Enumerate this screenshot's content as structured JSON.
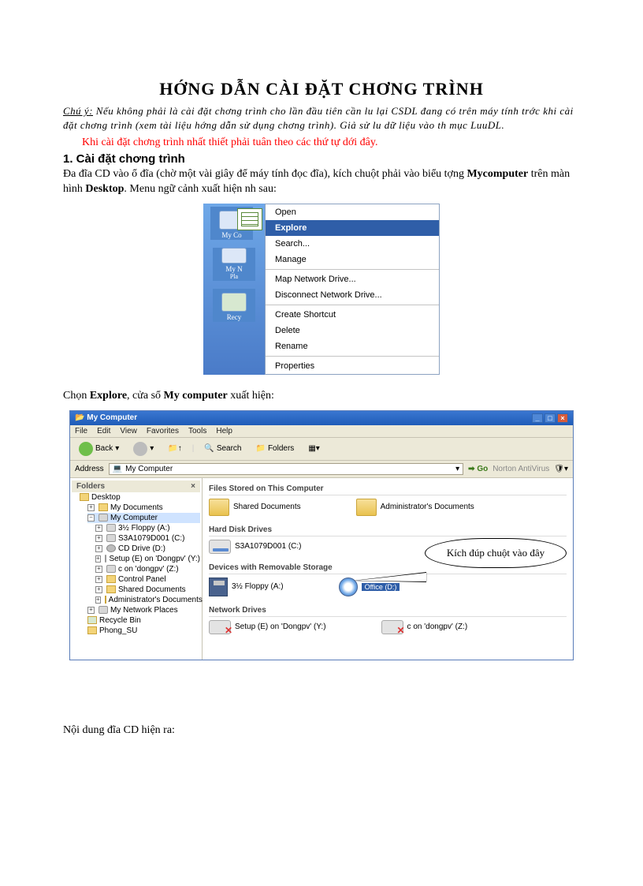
{
  "title": "HỚNG   DẪN CÀI ĐẶT CHƠNG    TRÌNH",
  "note_label": "Chú ý:",
  "note_body": " Nếu không phải là cài đặt chơng   trình cho lần đầu tiên cần lu   lại CSDL đang có trên máy tính trớc   khi cài đặt chơng   trình (xem tài liệu hớng   dẫn sử dụng chơng   trình). Giả sử lu   dữ liệu vào th   mục LuuDL.",
  "red_text": "Khi cài đặt chơng   trình nhất thiết phải tuân theo các thứ tự dới   đây.",
  "h1": "1. Cài đặt chơng   trình",
  "para1_a": "Đa   đĩa CD vào ổ đĩa (chờ một vài giây để máy tính đọc đĩa), kích chuột phải vào biểu tợng   ",
  "para1_b": "Mycomputer",
  "para1_c": " trên màn hình ",
  "para1_d": "Desktop",
  "para1_e": ". Menu ngữ cảnh xuất hiện nh   sau:",
  "ctx": {
    "myco": "My Co",
    "myn": "My N",
    "pla": "Pla",
    "recy": "Recy",
    "items": [
      "Open",
      "Explore",
      "Search...",
      "Manage",
      "Map Network Drive...",
      "Disconnect Network Drive...",
      "Create Shortcut",
      "Delete",
      "Rename",
      "Properties"
    ]
  },
  "para2_a": "Chọn ",
  "para2_b": "Explore",
  "para2_c": ", cửa sổ ",
  "para2_d": "My computer",
  "para2_e": " xuất hiện:",
  "explorer": {
    "title": "My Computer",
    "menu": [
      "File",
      "Edit",
      "View",
      "Favorites",
      "Tools",
      "Help"
    ],
    "back": "Back",
    "search": "Search",
    "folders": "Folders",
    "addr_label": "Address",
    "addr_value": "My Computer",
    "go": "Go",
    "norton": "Norton AntiVirus",
    "tree_hdr": "Folders",
    "tree": {
      "desktop": "Desktop",
      "mydocs": "My Documents",
      "mycomp": "My Computer",
      "floppy": "3½ Floppy (A:)",
      "cdrive": "S3A1079D001 (C:)",
      "cddrive": "CD Drive (D:)",
      "setup": "Setup (E) on 'Dongpv' (Y:)",
      "condong": "c on 'dongpv' (Z:)",
      "cpanel": "Control Panel",
      "shared": "Shared Documents",
      "admin": "Administrator's Documents",
      "netpl": "My Network Places",
      "recycle": "Recycle Bin",
      "phong": "Phong_SU"
    },
    "sect1": "Files Stored on This Computer",
    "shared_docs": "Shared Documents",
    "admin_docs": "Administrator's Documents",
    "sect2": "Hard Disk Drives",
    "hdd": "S3A1079D001 (C:)",
    "sect3": "Devices with Removable Storage",
    "floppy_lbl": "3½ Floppy (A:)",
    "cd_lbl": "Office (D:)",
    "sect4": "Network Drives",
    "net1": "Setup (E) on 'Dongpv' (Y:)",
    "net2": "c on 'dongpv' (Z:)"
  },
  "callout": "Kích đúp chuột vào đây",
  "para3": "Nội dung đĩa CD hiện ra:"
}
